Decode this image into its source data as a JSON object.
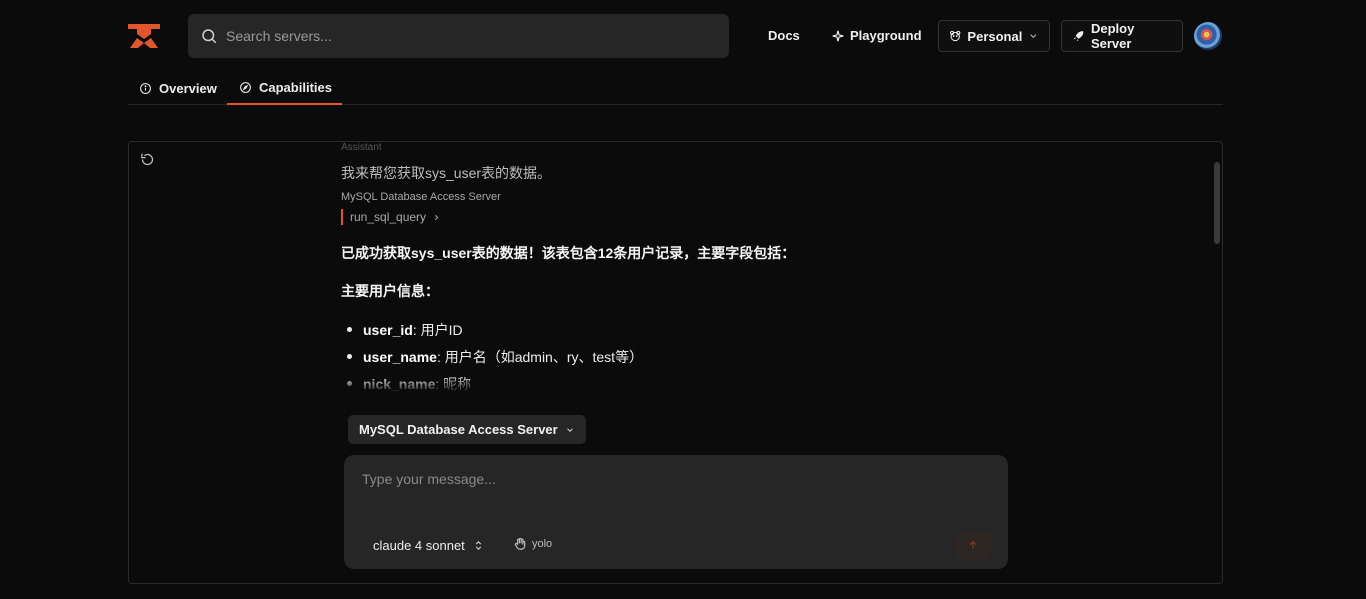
{
  "header": {
    "search_placeholder": "Search servers...",
    "docs_label": "Docs",
    "playground_label": "Playground",
    "workspace_label": "Personal",
    "deploy_label": "Deploy Server"
  },
  "tabs": [
    {
      "label": "Overview",
      "icon": "info-icon",
      "active": false
    },
    {
      "label": "Capabilities",
      "icon": "compass-icon",
      "active": true
    }
  ],
  "conversation": {
    "role_label": "Assistant",
    "intro_text": "我来帮您获取sys_user表的数据。",
    "tool_server": "MySQL Database Access Server",
    "tool_call": "run_sql_query",
    "summary": "已成功获取sys_user表的数据！该表包含12条用户记录，主要字段包括：",
    "section_title": "主要用户信息：",
    "fields": [
      {
        "name": "user_id",
        "desc": ": 用户ID"
      },
      {
        "name": "user_name",
        "desc": ": 用户名（如admin、ry、test等）"
      },
      {
        "name": "nick_name",
        "desc": ": 昵称"
      }
    ]
  },
  "composer": {
    "server_selector": "MySQL Database Access Server",
    "placeholder": "Type your message...",
    "model": "claude 4 sonnet",
    "mode": "yolo"
  },
  "colors": {
    "accent": "#e2562b",
    "background": "#0b0b0b",
    "surface": "#262626"
  }
}
